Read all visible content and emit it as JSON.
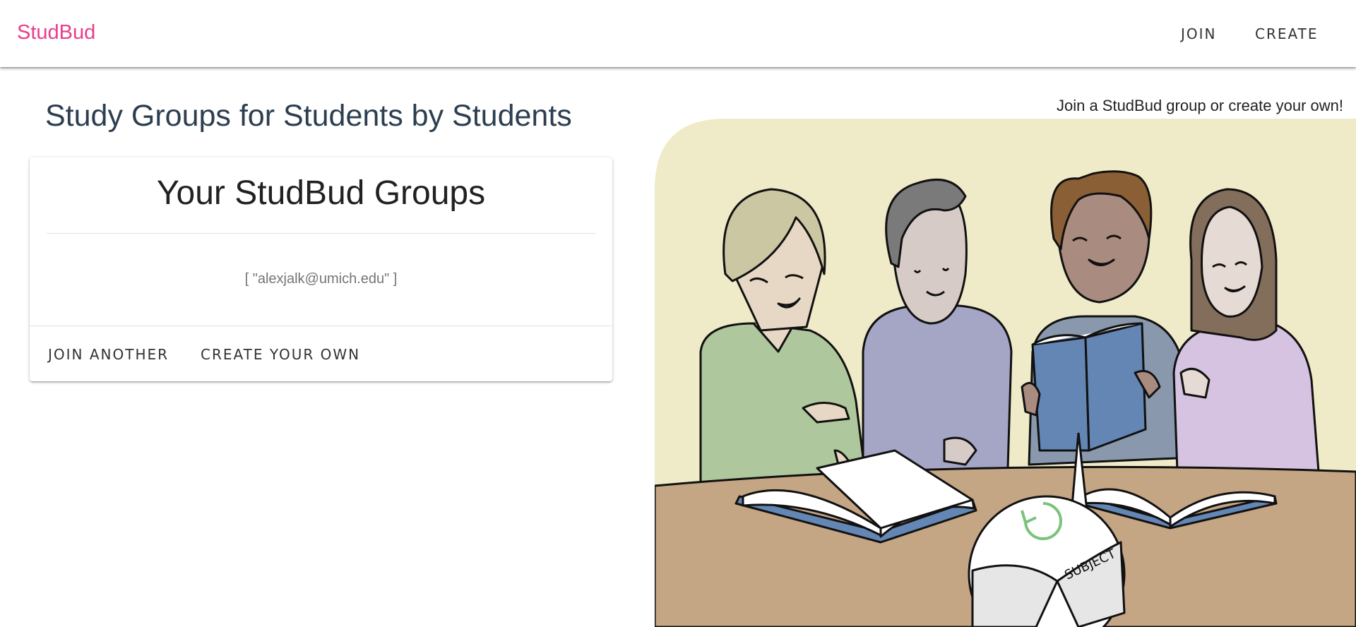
{
  "appbar": {
    "brand": "StudBud",
    "nav": {
      "join_label": "JOIN",
      "create_label": "CREATE"
    }
  },
  "main": {
    "headline": "Study Groups for Students by Students",
    "tagline": "Join a StudBud group or create your own!"
  },
  "card": {
    "title": "Your StudBud Groups",
    "members_text": "[ \"alexjalk@umich.edu\" ]",
    "join_another_label": "JOIN ANOTHER",
    "create_own_label": "CREATE YOUR OWN"
  },
  "illustration": {
    "book_label": "SUBJECT",
    "colors": {
      "background": "#efebc8",
      "table": "#c4a584",
      "book_blue": "#6486b4",
      "shirt_green": "#afc79d",
      "shirt_purple": "#a5a6c6",
      "shirt_lavender": "#d5c3e1",
      "refresh_green": "#7cc27b"
    }
  },
  "colors": {
    "brand": "#e83e8c",
    "headline": "#2c3e50"
  }
}
